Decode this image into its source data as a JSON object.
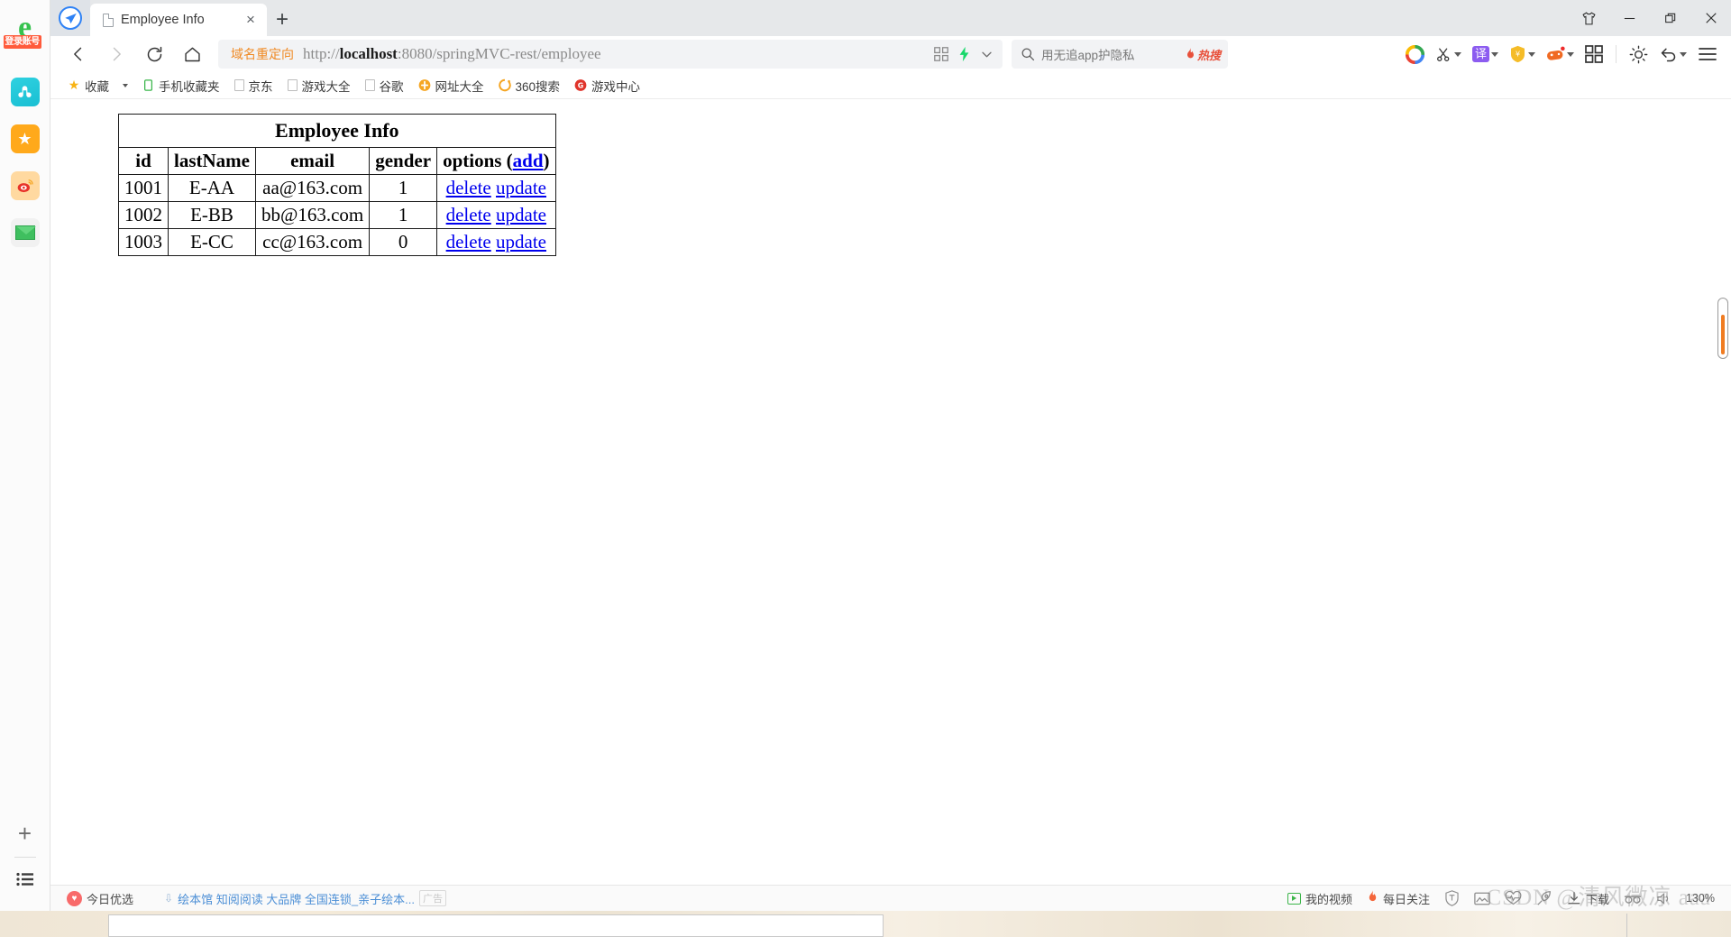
{
  "window": {
    "controls": [
      {
        "name": "skin-button",
        "glyph": "skin"
      },
      {
        "name": "minimize-button",
        "glyph": "minimize"
      },
      {
        "name": "restore-button",
        "glyph": "restore"
      },
      {
        "name": "close-button",
        "glyph": "close"
      }
    ]
  },
  "tabs": {
    "active": {
      "title": "Employee Info",
      "close_label": "×"
    },
    "new_tab_label": "+"
  },
  "toolbar": {
    "back_label": "‹",
    "forward_label": "›",
    "reload_label": "↻",
    "home_label": "⌂",
    "omnibox": {
      "redirect_tag": "域名重定向",
      "url_prefix": "http://",
      "url_host": "localhost",
      "url_rest": ":8080/springMVC-rest/employee",
      "qr_icon": "qr-code-icon",
      "lightning_icon": "lightning-icon",
      "chevron_icon": "chevron-down-icon"
    },
    "search": {
      "placeholder": "用无追app护隐私",
      "badge": "热搜"
    },
    "icons": [
      {
        "name": "360-logo-icon",
        "label": "360",
        "caret": false
      },
      {
        "name": "scissors-screenshot-icon",
        "label": "✂",
        "caret": true
      },
      {
        "name": "translate-icon",
        "label": "译",
        "caret": true
      },
      {
        "name": "shopping-shield-icon",
        "label": "¥",
        "caret": true
      },
      {
        "name": "game-controller-icon",
        "label": "game",
        "caret": true
      },
      {
        "name": "apps-grid-icon",
        "label": "grid",
        "caret": false
      },
      {
        "name": "brightness-icon",
        "label": "sun",
        "caret": false
      },
      {
        "name": "undo-icon",
        "label": "↶",
        "caret": true
      },
      {
        "name": "menu-icon",
        "label": "≡",
        "caret": false
      }
    ]
  },
  "bookmarks": [
    {
      "label": "收藏",
      "icon": "star-icon",
      "color": "#f8b313"
    },
    {
      "label": "手机收藏夹",
      "icon": "phone-icon",
      "color": "#39b54a"
    },
    {
      "label": "京东",
      "icon": "doc-icon",
      "color": "#bdbdbd"
    },
    {
      "label": "游戏大全",
      "icon": "doc-icon",
      "color": "#bdbdbd"
    },
    {
      "label": "谷歌",
      "icon": "doc-icon",
      "color": "#bdbdbd"
    },
    {
      "label": "网址大全",
      "icon": "hao123-icon",
      "color": "#f5a623"
    },
    {
      "label": "360搜索",
      "icon": "360-search-icon",
      "color": "#f5a623"
    },
    {
      "label": "游戏中心",
      "icon": "game-center-icon",
      "color": "#e0342b"
    }
  ],
  "sidebar": {
    "logo": {
      "glyph": "e",
      "badge": "登录账号",
      "name": "browser-account-logo"
    },
    "items": [
      {
        "name": "sidebar-item-cloud",
        "icon": "cloud-disk-icon"
      },
      {
        "name": "sidebar-item-favorites",
        "icon": "star-icon"
      },
      {
        "name": "sidebar-item-weibo",
        "icon": "weibo-icon"
      },
      {
        "name": "sidebar-item-mail",
        "icon": "mail-icon"
      }
    ],
    "add_label": "+",
    "list_icon": "list-icon"
  },
  "page": {
    "table": {
      "caption": "Employee Info",
      "headers": [
        "id",
        "lastName",
        "email",
        "gender"
      ],
      "options_header": "options",
      "options_add_link": "add",
      "options_paren_open": " (",
      "options_paren_close": ")",
      "delete_label": "delete",
      "update_label": "update",
      "rows": [
        {
          "id": "1001",
          "lastName": "E-AA",
          "email": "aa@163.com",
          "gender": "1"
        },
        {
          "id": "1002",
          "lastName": "E-BB",
          "email": "bb@163.com",
          "gender": "1"
        },
        {
          "id": "1003",
          "lastName": "E-CC",
          "email": "cc@163.com",
          "gender": "0"
        }
      ]
    }
  },
  "statusbar": {
    "today_pick": "今日优选",
    "expand_icon": "chevron-double-down-icon",
    "ad_text": "绘本馆 知阅阅读 大品牌 全国连锁_亲子绘本...",
    "ad_tag": "广告",
    "my_video": "我的视频",
    "daily_focus": "每日关注",
    "icons": [
      {
        "name": "shield-icon"
      },
      {
        "name": "image-icon"
      },
      {
        "name": "heartbeat-icon"
      },
      {
        "name": "rocket-icon"
      }
    ],
    "download": "下载",
    "incognito_icon": "incognito-glasses-icon",
    "zoom_level": "130%"
  },
  "watermark": "CSDN @清风微凉 aaa",
  "colors": {
    "accent_orange": "#f07c22",
    "link_blue": "#0000ee",
    "redirect_orange": "#f08a24",
    "hot_red": "#e8503a"
  }
}
